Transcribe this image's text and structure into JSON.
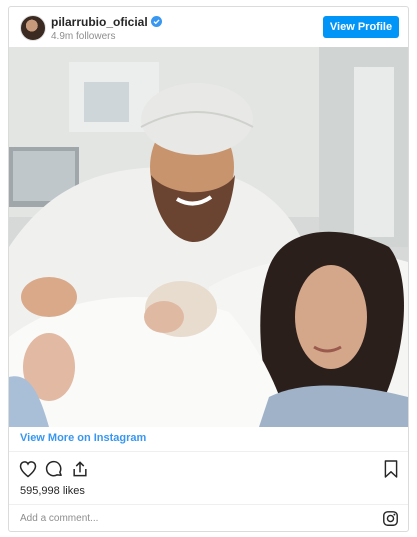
{
  "header": {
    "username": "pilarrubio_oficial",
    "followers": "4.9m followers",
    "view_profile_label": "View Profile"
  },
  "photo": {
    "alt": "Couple with newborn baby in hospital bed"
  },
  "footer": {
    "view_more_label": "View More on Instagram",
    "likes": "595,998 likes",
    "comment_placeholder": "Add a comment..."
  },
  "icons": {
    "verified": "verified-badge-icon",
    "like": "heart-icon",
    "comment": "comment-bubble-icon",
    "share": "share-icon",
    "save": "bookmark-icon",
    "instagram": "instagram-logo-icon"
  },
  "colors": {
    "accent": "#0095f6",
    "link": "#3897f0",
    "muted": "#8e8e8e"
  }
}
